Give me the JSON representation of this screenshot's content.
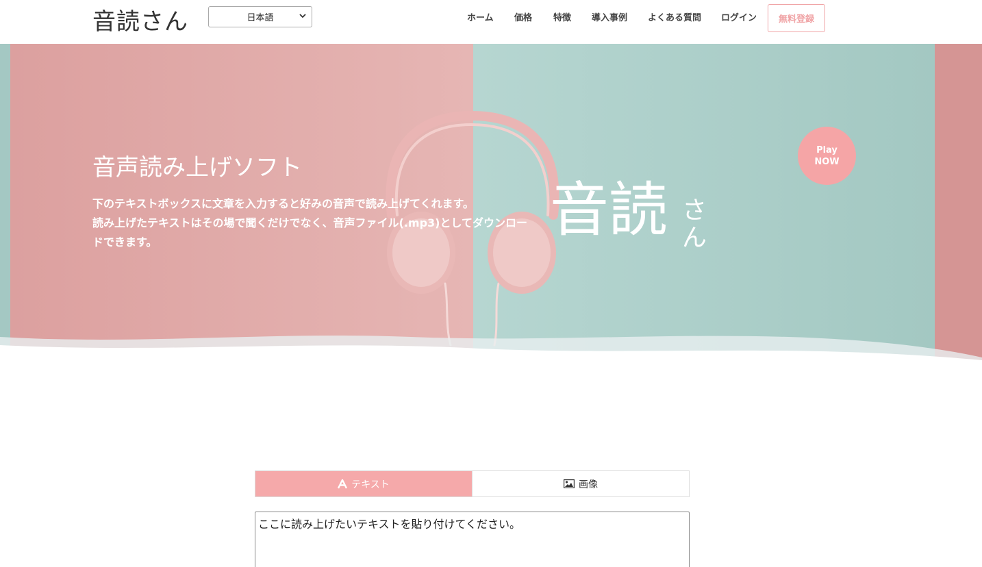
{
  "header": {
    "logo": "音読さん",
    "language": "日本語",
    "nav": [
      {
        "label": "ホーム"
      },
      {
        "label": "価格"
      },
      {
        "label": "特徴"
      },
      {
        "label": "導入事例"
      },
      {
        "label": "よくある質問"
      },
      {
        "label": "ログイン"
      }
    ],
    "signup": "無料登録"
  },
  "hero": {
    "title": "音声読み上げソフト",
    "desc_line1": "下のテキストボックスに文章を入力すると好みの音声で読み上げてくれます。",
    "desc_line2": "読み上げたテキストはその場で聞くだけでなく、音声ファイル(.mp3)としてダウンロードできます。",
    "logo_big": "音読",
    "logo_small": "さん",
    "play_line1": "Play",
    "play_line2": "NOW"
  },
  "tabs": [
    {
      "label": "テキスト",
      "icon": "font-icon",
      "active": true
    },
    {
      "label": "画像",
      "icon": "image-icon",
      "active": false
    }
  ],
  "textarea": {
    "value": "ここに読み上げたいテキストを貼り付けてください。"
  },
  "colors": {
    "pink": "#f5a9aa",
    "hero_pink": "#e3a9a8",
    "hero_teal": "#a9cdc8"
  }
}
